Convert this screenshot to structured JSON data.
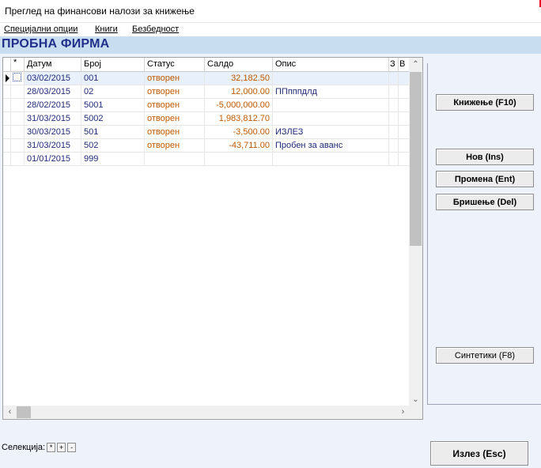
{
  "window": {
    "title": "Преглед на финансови налози за книжење"
  },
  "menu": [
    {
      "label": "Специјални опции"
    },
    {
      "label": "Книги"
    },
    {
      "label": "Безбедност"
    }
  ],
  "company": {
    "name": "ПРОБНА ФИРМА"
  },
  "grid": {
    "columns": [
      "*",
      "Датум",
      "Број",
      "Статус",
      "Салдо",
      "Опис",
      "З",
      "В"
    ],
    "rows": [
      {
        "date": "03/02/2015",
        "number": "001",
        "status": "отворен",
        "saldo": "32,182.50",
        "desc": ""
      },
      {
        "date": "28/03/2015",
        "number": "02",
        "status": "отворен",
        "saldo": "12,000.00",
        "desc": "ППпппдлд"
      },
      {
        "date": "28/02/2015",
        "number": "5001",
        "status": "отворен",
        "saldo": "-5,000,000.00",
        "desc": ""
      },
      {
        "date": "31/03/2015",
        "number": "5002",
        "status": "отворен",
        "saldo": "1,983,812.70",
        "desc": ""
      },
      {
        "date": "30/03/2015",
        "number": "501",
        "status": "отворен",
        "saldo": "-3,500.00",
        "desc": "ИЗЛЕЗ"
      },
      {
        "date": "31/03/2015",
        "number": "502",
        "status": "отворен",
        "saldo": "-43,711.00",
        "desc": "Пробен за аванс"
      },
      {
        "date": "01/01/2015",
        "number": "999",
        "status": "",
        "saldo": "",
        "desc": ""
      }
    ]
  },
  "buttons": {
    "post": "Книжење (F10)",
    "new": "Нов (Ins)",
    "edit": "Промена (Ent)",
    "delete": "Бришење (Del)",
    "synthetics": "Синтетики (F8)",
    "exit": "Излез (Esc)"
  },
  "selection": {
    "label": "Селекција:",
    "all": "*",
    "plus": "+",
    "minus": "-"
  },
  "colors": {
    "company_bar": "#c9ddf0",
    "company_text": "#1f2f8a",
    "status_text": "#c05800",
    "value_text": "#1f2a7a"
  }
}
